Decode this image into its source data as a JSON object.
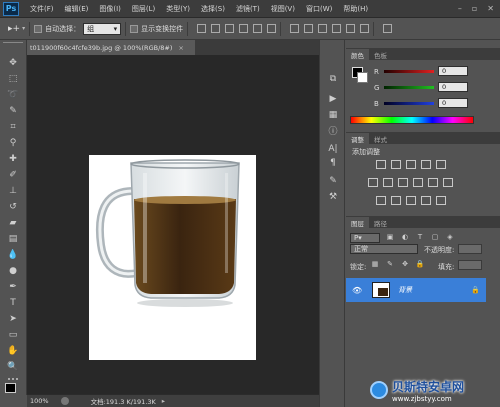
{
  "app": {
    "logo": "Ps"
  },
  "menu": [
    "文件(F)",
    "编辑(E)",
    "图像(I)",
    "图层(L)",
    "类型(Y)",
    "选择(S)",
    "滤镜(T)",
    "视图(V)",
    "窗口(W)",
    "帮助(H)"
  ],
  "window_controls": [
    "–",
    "▫",
    "✕"
  ],
  "options": {
    "auto_select_label": "自动选择：",
    "auto_select_value": "组",
    "show_transform_label": "显示变换控件"
  },
  "document": {
    "tab_title": "t011900f60c4fcfe39b.jpg @ 100%(RGB/8#)",
    "tab_close": "×"
  },
  "status": {
    "zoom": "100%",
    "doc_info": "文档:191.3 K/191.3K"
  },
  "panels": {
    "color": {
      "tabs": [
        "颜色",
        "色板"
      ],
      "channels": [
        {
          "label": "R",
          "value": "0",
          "color": "#e02020"
        },
        {
          "label": "G",
          "value": "0",
          "color": "#20c020"
        },
        {
          "label": "B",
          "value": "0",
          "color": "#2040e0"
        }
      ]
    },
    "adjustments": {
      "tabs": [
        "调整",
        "样式"
      ],
      "title": "添加调整"
    },
    "layers": {
      "tabs": [
        "图层",
        "路径"
      ],
      "blend_mode": "正常",
      "opacity_label": "不透明度:",
      "lock_label": "锁定:",
      "fill_label": "填充:",
      "layer_name": "背景"
    }
  },
  "watermark": {
    "line1": "贝斯特安卓网",
    "line2": "www.zjbstyy.com"
  },
  "colors": {
    "accent": "#3a7fd8",
    "canvas_bg": "#282828",
    "panel_bg": "#535353"
  }
}
